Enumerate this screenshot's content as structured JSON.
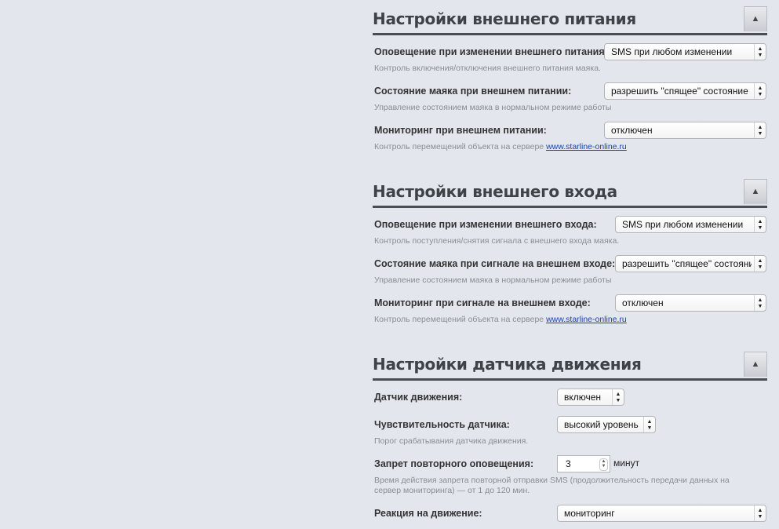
{
  "sections": {
    "power": {
      "title": "Настройки внешнего питания",
      "collapse_icon": "chevron-up-icon",
      "rows": [
        {
          "label": "Оповещение при изменении внешнего питания:",
          "value": "SMS при любом изменении",
          "hint": "Контроль включения/отключения внешнего питания маяка."
        },
        {
          "label": "Состояние маяка при внешнем питании:",
          "value": "разрешить \"спящее\" состояние",
          "hint": "Управление состоянием маяка в нормальном режиме работы"
        },
        {
          "label": "Мониторинг при внешнем питании:",
          "value": "отключен",
          "hint": "Контроль перемещений объекта на сервере",
          "link": "www.starline-online.ru"
        }
      ]
    },
    "input": {
      "title": "Настройки внешнего входа",
      "collapse_icon": "chevron-up-icon",
      "rows": [
        {
          "label": "Оповещение при изменении внешнего входа:",
          "value": "SMS при любом изменении",
          "hint": "Контроль поступления/снятия сигнала с внешнего входа маяка."
        },
        {
          "label": "Состояние маяка при сигнале на внешнем входе:",
          "value": "разрешить \"спящее\" состояние",
          "hint": "Управление состоянием маяка в нормальном режиме работы"
        },
        {
          "label": "Мониторинг при сигнале на внешнем входе:",
          "value": "отключен",
          "hint": "Контроль перемещений объекта на сервере",
          "link": "www.starline-online.ru"
        }
      ]
    },
    "motion": {
      "title": "Настройки датчика движения",
      "collapse_icon": "chevron-up-icon",
      "sensor": {
        "label": "Датчик движения:",
        "value": "включен"
      },
      "sensitivity": {
        "label": "Чувствительность датчика:",
        "value": "высокий уровень",
        "hint": "Порог срабатывания датчика движения."
      },
      "repeat_block": {
        "label": "Запрет повторного оповещения:",
        "value": "3",
        "unit": "минут",
        "hint_line1": "Время действия запрета повторной отправки SMS (продолжительность передачи данных на",
        "hint_line2": "сервер мониторинга) — от 1 до 120 мин."
      },
      "reaction": {
        "label": "Реакция на движение:",
        "value": "мониторинг"
      }
    }
  }
}
